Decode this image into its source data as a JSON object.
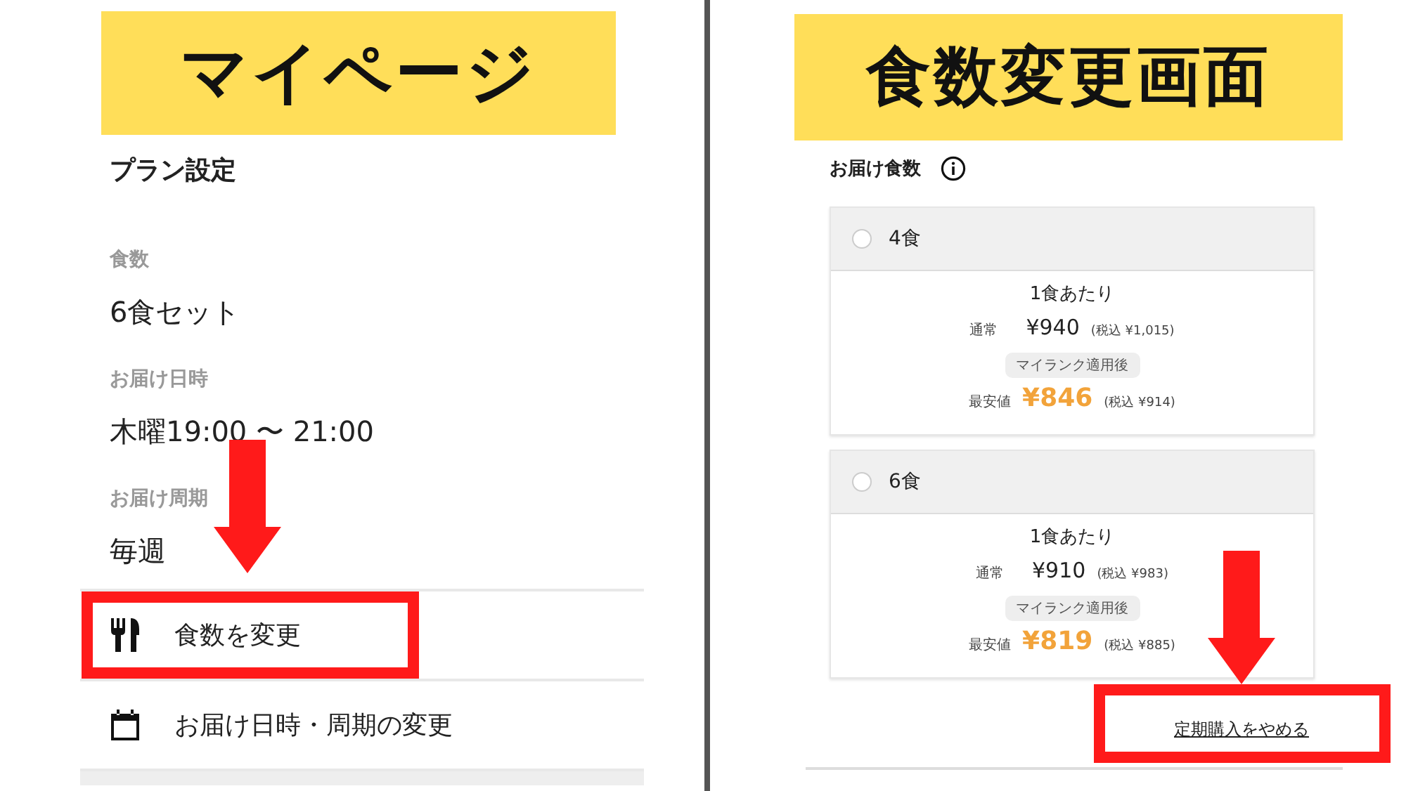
{
  "left_screen": {
    "banner": "マイページ",
    "section_title": "プラン設定",
    "fields": [
      {
        "label": "食数",
        "value": "6食セット"
      },
      {
        "label": "お届け日時",
        "value": "木曜19:00 〜 21:00"
      },
      {
        "label": "お届け周期",
        "value": "毎週"
      }
    ],
    "menu_items": [
      {
        "kind": "meal",
        "label": "食数を変更",
        "highlighted": true
      },
      {
        "kind": "calendar",
        "label": "お届け日時・周期の変更",
        "highlighted": false
      }
    ]
  },
  "right_screen": {
    "banner": "食数変更画面",
    "section_title": "お届け食数",
    "options": [
      {
        "label": "4食",
        "selected": false,
        "per_meal": "1食あたり",
        "regular_label": "通常",
        "regular_price": "¥940",
        "regular_tax": "(税込 ¥1,015)",
        "badge": "マイランク適用後",
        "best_label": "最安値",
        "best_price": "¥846",
        "best_tax": "(税込 ¥914)"
      },
      {
        "label": "6食",
        "selected": false,
        "per_meal": "1食あたり",
        "regular_label": "通常",
        "regular_price": "¥910",
        "regular_tax": "(税込 ¥983)",
        "badge": "マイランク適用後",
        "best_label": "最安値",
        "best_price": "¥819",
        "best_tax": "(税込 ¥885)"
      }
    ],
    "cancel_link": {
      "label": "定期購入をやめる",
      "highlighted": true
    }
  }
}
